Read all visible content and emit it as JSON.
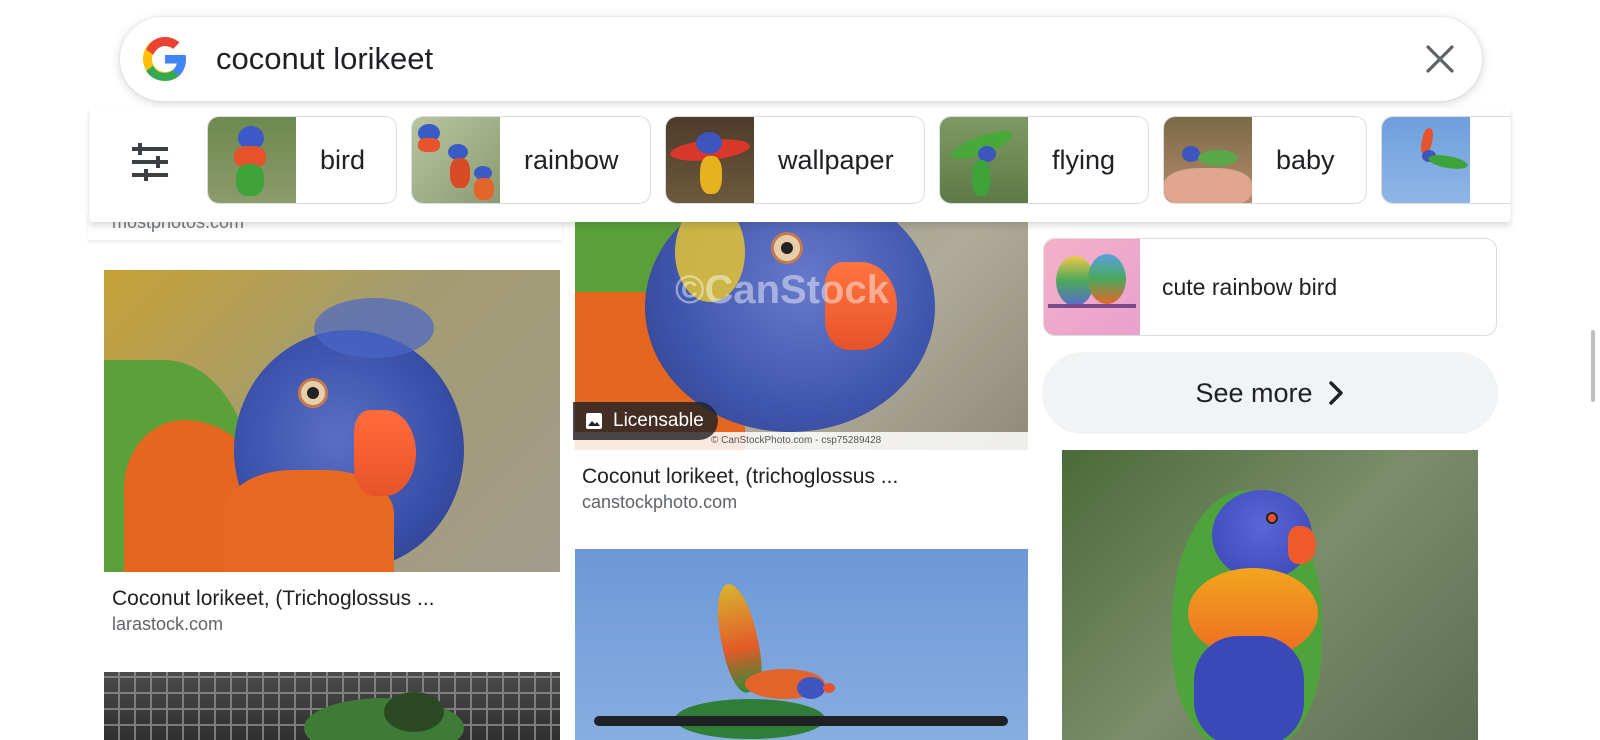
{
  "search": {
    "query": "coconut lorikeet",
    "logo_icon": "google-g-icon",
    "clear_icon": "close-icon"
  },
  "filters": {
    "tune_icon": "tune-icon",
    "chips": [
      {
        "label": "bird"
      },
      {
        "label": "rainbow"
      },
      {
        "label": "wallpaper"
      },
      {
        "label": "flying"
      },
      {
        "label": "baby"
      }
    ]
  },
  "results": {
    "top_source": "mostphotos.com",
    "items": [
      {
        "title": "Coconut lorikeet, (Trichoglossus ...",
        "source": "larastock.com"
      },
      {
        "title": "Coconut lorikeet, (trichoglossus ...",
        "source": "canstockphoto.com",
        "badge": "Licensable",
        "watermark": "©CanStock",
        "caption": "© CanStockPhoto.com - csp75289428"
      }
    ]
  },
  "related": {
    "label": "cute rainbow bird",
    "see_more": "See more"
  },
  "colors": {
    "google_blue": "#4285F4",
    "google_red": "#EA4335",
    "google_yellow": "#FBBC05",
    "google_green": "#34A853"
  }
}
